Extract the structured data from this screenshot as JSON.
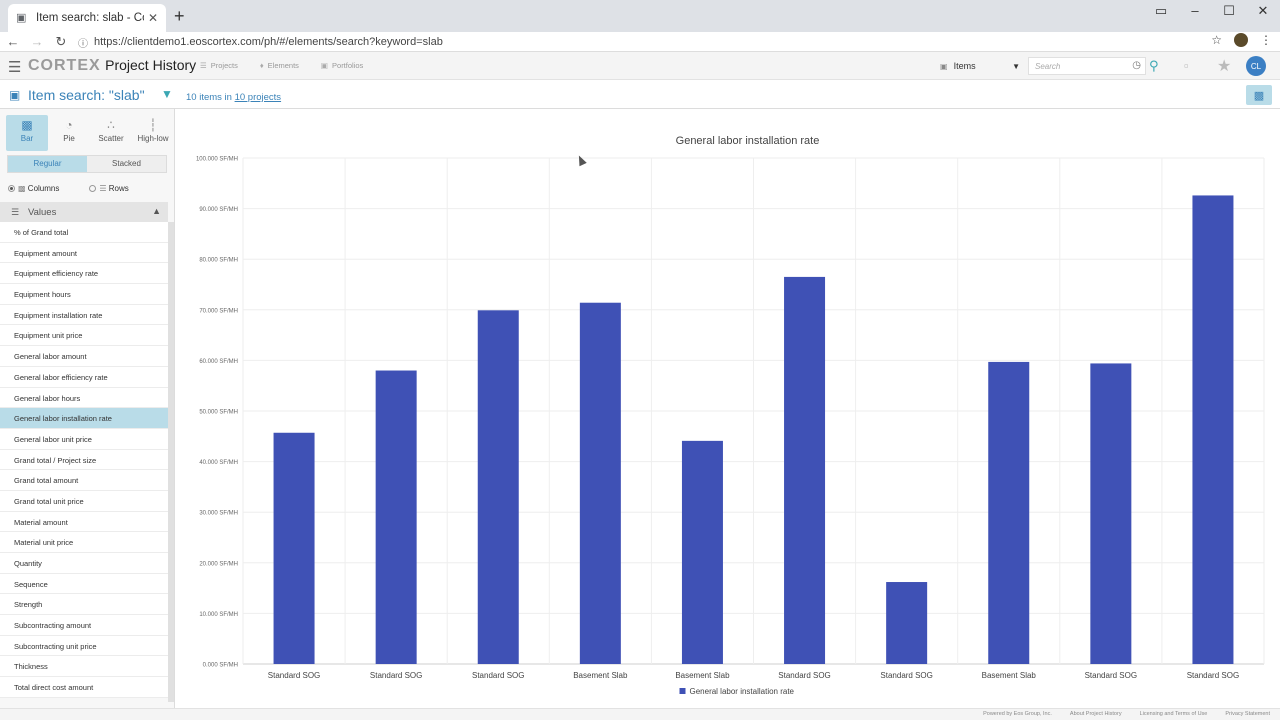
{
  "browser": {
    "tab_title": "Item search: slab - Cortex Project",
    "url": "https://clientdemo1.eoscortex.com/ph/#/elements/search?keyword=slab"
  },
  "header": {
    "logo_brand": "CORTEX",
    "logo_product": "Project History",
    "nav": [
      "Projects",
      "Elements",
      "Portfolios"
    ],
    "item_type": "Items",
    "search_placeholder": "Search",
    "user_initials": "CL"
  },
  "subheader": {
    "title": "Item search: \"slab\"",
    "count_prefix": "10 items in",
    "count_link": "10 projects"
  },
  "left": {
    "chart_types": [
      "Bar",
      "Pie",
      "Scatter",
      "High-low"
    ],
    "active_chart_type": "Bar",
    "modes": [
      "Regular",
      "Stacked"
    ],
    "active_mode": "Regular",
    "orient_columns": "Columns",
    "orient_rows": "Rows",
    "values_header": "Values",
    "values": [
      "% of Grand total",
      "Equipment amount",
      "Equipment efficiency rate",
      "Equipment hours",
      "Equipment installation rate",
      "Equipment unit price",
      "General labor amount",
      "General labor efficiency rate",
      "General labor hours",
      "General labor installation rate",
      "General labor unit price",
      "Grand total / Project size",
      "Grand total amount",
      "Grand total unit price",
      "Material amount",
      "Material unit price",
      "Quantity",
      "Sequence",
      "Strength",
      "Subcontracting amount",
      "Subcontracting unit price",
      "Thickness",
      "Total direct cost amount"
    ],
    "selected_value": "General labor installation rate"
  },
  "chart_data": {
    "type": "bar",
    "title": "General labor installation rate",
    "categories": [
      "Standard SOG",
      "Standard SOG",
      "Standard SOG",
      "Basement Slab",
      "Basement Slab",
      "Standard SOG",
      "Standard SOG",
      "Basement Slab",
      "Standard SOG",
      "Standard SOG"
    ],
    "series": [
      {
        "name": "General labor installation rate",
        "values": [
          45.7,
          58.0,
          69.9,
          71.4,
          44.1,
          76.5,
          16.2,
          59.7,
          59.4,
          92.6
        ]
      }
    ],
    "yticks": [
      "0.000 SF/MH",
      "10.000 SF/MH",
      "20.000 SF/MH",
      "30.000 SF/MH",
      "40.000 SF/MH",
      "50.000 SF/MH",
      "60.000 SF/MH",
      "70.000 SF/MH",
      "80.000 SF/MH",
      "90.000 SF/MH",
      "100.000 SF/MH"
    ],
    "ylim": [
      0,
      100
    ],
    "bar_color": "#3f51b5",
    "grid": true,
    "legend": "bottom"
  },
  "footer": {
    "links": [
      "Powered by Eos Group, Inc.",
      "About Project History",
      "Licensing and Terms of Use",
      "Privacy Statement"
    ]
  }
}
